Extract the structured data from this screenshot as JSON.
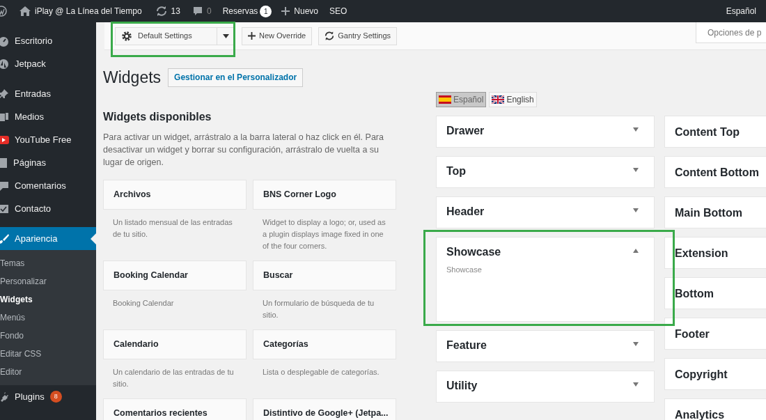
{
  "admin_bar": {
    "site_name": "iPlay @ La Línea del Tiempo",
    "updates": "13",
    "comments": "0",
    "reservas": "Reservas",
    "reservas_count": "1",
    "new": "Nuevo",
    "seo": "SEO",
    "language": "Español"
  },
  "sidebar": {
    "items": [
      {
        "kind": "dashboard",
        "label": "Escritorio",
        "selected": false
      },
      {
        "kind": "jetpack",
        "label": "Jetpack",
        "selected": false
      },
      {
        "kind": "pin",
        "label": "Entradas",
        "selected": false
      },
      {
        "kind": "media",
        "label": "Medios",
        "selected": false
      },
      {
        "kind": "youtube",
        "label": "YouTube Free",
        "selected": false
      },
      {
        "kind": "page",
        "label": "Páginas",
        "selected": false
      },
      {
        "kind": "comment",
        "label": "Comentarios",
        "selected": false
      },
      {
        "kind": "mail",
        "label": "Contacto",
        "selected": false
      },
      {
        "kind": "brush",
        "label": "Apariencia",
        "selected": true,
        "children": [
          {
            "label": "Temas",
            "selected": false
          },
          {
            "label": "Personalizar",
            "selected": false
          },
          {
            "label": "Widgets",
            "selected": true
          },
          {
            "label": "Menús",
            "selected": false
          },
          {
            "label": "Fondo",
            "selected": false
          },
          {
            "label": "Editar CSS",
            "selected": false
          },
          {
            "label": "Editor",
            "selected": false
          }
        ]
      },
      {
        "kind": "plug",
        "label": "Plugins",
        "badge": "8",
        "selected": false
      }
    ]
  },
  "gantry_toolbar": {
    "settings_dropdown": {
      "label": "Default Settings",
      "highlighted": true
    },
    "buttons": [
      {
        "kind": "add",
        "label": "New Override"
      },
      {
        "kind": "refresh",
        "label": "Gantry Settings"
      }
    ]
  },
  "screen_options": "Opciones de p",
  "page": {
    "title": "Widgets",
    "customizer_button": "Gestionar en el Personalizador"
  },
  "available": {
    "title": "Widgets disponibles",
    "description": "Para activar un widget, arrástralo a la barra lateral o haz click en él. Para desactivar un widget y borrar su configuración, arrástralo de vuelta a su lugar de origen.",
    "widgets": [
      {
        "title": "Archivos",
        "description": "Un listado mensual de las entradas de tu sitio."
      },
      {
        "title": "BNS Corner Logo",
        "description": "Widget to display a logo; or, used as a plugin displays image fixed in one of the four corners."
      },
      {
        "title": "Booking Calendar",
        "description": "Booking Calendar"
      },
      {
        "title": "Buscar",
        "description": "Un formulario de búsqueda de tu sitio."
      },
      {
        "title": "Calendario",
        "description": "Un calendario de las entradas de tu sitio."
      },
      {
        "title": "Categorías",
        "description": "Lista o desplegable de categorías."
      },
      {
        "title": "Comentarios recientes"
      },
      {
        "title": "Distintivo de Google+ (Jetpa..."
      }
    ]
  },
  "languages": [
    {
      "kind": "es",
      "label": "Español",
      "selected": true
    },
    {
      "kind": "uk",
      "label": "English",
      "selected": false
    }
  ],
  "areas_column_1": [
    {
      "title": "Drawer",
      "expanded": false,
      "highlighted": false
    },
    {
      "title": "Top",
      "expanded": false,
      "highlighted": false
    },
    {
      "title": "Header",
      "expanded": false,
      "highlighted": false
    },
    {
      "title": "Showcase",
      "expanded": true,
      "description": "Showcase",
      "highlighted": true
    },
    {
      "title": "Feature",
      "expanded": false,
      "highlighted": false
    },
    {
      "title": "Utility",
      "expanded": false,
      "highlighted": false
    }
  ],
  "areas_column_2": [
    {
      "title": "Content Top"
    },
    {
      "title": "Content Bottom"
    },
    {
      "title": "Main Bottom"
    },
    {
      "title": "Extension"
    },
    {
      "title": "Bottom"
    },
    {
      "title": "Footer"
    },
    {
      "title": "Copyright"
    },
    {
      "title": "Analytics"
    }
  ]
}
